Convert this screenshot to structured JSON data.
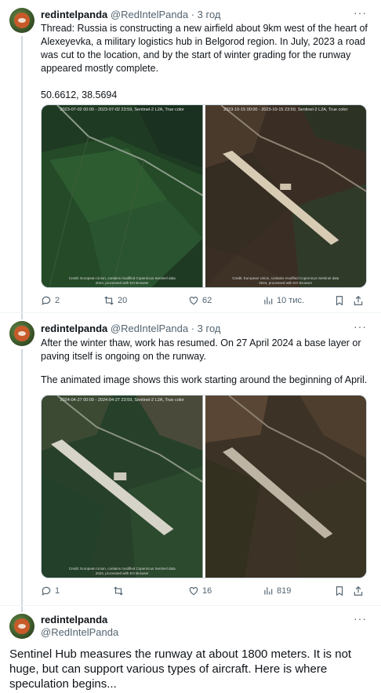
{
  "tweets": [
    {
      "name": "redintelpanda",
      "handle": "@RedIntelPanda",
      "time": "· 3 год",
      "paragraphs": [
        "Thread: Russia is constructing a new airfield about 9km west of the heart of Alexeyevka, a military logistics hub in Belgorod region. In July, 2023 a road was cut to the location, and by the start of winter grading for the runway appeared mostly complete.",
        "50.6612, 38.5694"
      ],
      "images": [
        {
          "caption": "2023-07-02 00:00 - 2023-07-02 23:59, Sentinel-2 L2A, True color",
          "credit": "Credit: European Union, contains modified Copernicus Sentinel data\n2024, processed with EO Browser"
        },
        {
          "caption": "2023-10-15 00:00 - 2023-10-15 23:59, Sentinel-2 L2A, True color",
          "credit": "Credit: European Union, contains modified Copernicus Sentinel data\n2024, processed with EO Browser"
        }
      ],
      "stats": {
        "replies": "2",
        "reposts": "20",
        "likes": "62",
        "views": "10 тис."
      }
    },
    {
      "name": "redintelpanda",
      "handle": "@RedIntelPanda",
      "time": "· 3 год",
      "paragraphs": [
        "After the winter thaw, work has resumed. On 27 April 2024 a base layer or paving itself is ongoing on the runway.",
        "The animated image shows this work starting around the beginning of April."
      ],
      "images": [
        {
          "caption": "2024-04-27 00:00 - 2024-04-27 23:59, Sentinel-2 L2A, True color",
          "credit": "Credit: European Union, contains modified Copernicus Sentinel data\n2024, processed with EO Browser"
        },
        {
          "caption": "",
          "credit": ""
        }
      ],
      "stats": {
        "replies": "1",
        "reposts": "",
        "likes": "16",
        "views": "819"
      }
    },
    {
      "name": "redintelpanda",
      "handle": "@RedIntelPanda",
      "text": "Sentinel Hub measures the runway at about 1800 meters. It is not huge, but can support various types of aircraft. Here is where speculation begins..."
    }
  ],
  "icons": {
    "reply": "reply-icon",
    "repost": "repost-icon",
    "like": "heart-icon",
    "views": "views-icon",
    "bookmark": "bookmark-icon",
    "share": "share-icon",
    "more": "more-icon"
  },
  "colors": {
    "text": "#0f1419",
    "secondary": "#536471",
    "border": "#cfd9de"
  }
}
